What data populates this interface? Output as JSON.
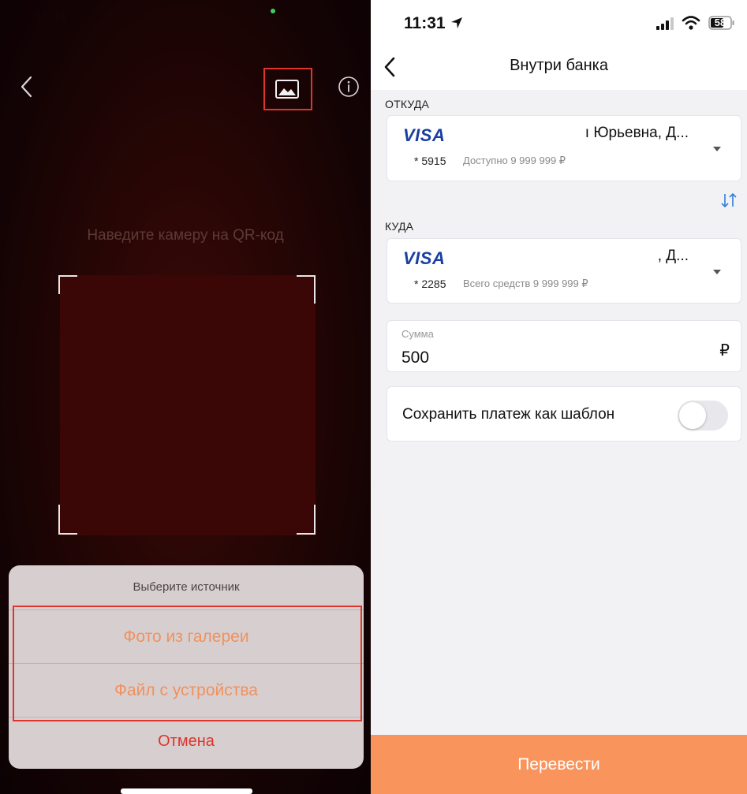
{
  "left": {
    "status_time": "11:31",
    "scan_hint": "Наведите камеру на QR-код",
    "sheet": {
      "title": "Выберите источник",
      "option_gallery": "Фото из галереи",
      "option_file": "Файл с устройства",
      "cancel": "Отмена"
    },
    "icons": {
      "back": "chevron-left-icon",
      "gallery": "image-icon",
      "info": "info-icon"
    },
    "colors": {
      "accent": "#f0915e",
      "cancel": "#e0322b",
      "highlight": "#e0352d"
    }
  },
  "right": {
    "status": {
      "time": "11:31",
      "battery": "58"
    },
    "nav": {
      "title": "Внутри банка"
    },
    "from": {
      "label": "ОТКУДА",
      "brand": "VISA",
      "holder": "ı Юрьевна, Д...",
      "number": "* 5915",
      "balance": "Доступно 9 999 999 ₽"
    },
    "to": {
      "label": "КУДА",
      "brand": "VISA",
      "holder": ", Д...",
      "number": "* 2285",
      "balance": "Всего средств 9 999 999 ₽"
    },
    "amount": {
      "label": "Сумма",
      "value": "500",
      "currency": "₽"
    },
    "template": {
      "label": "Сохранить платеж как шаблон",
      "enabled": false
    },
    "submit": {
      "label": "Перевести"
    },
    "colors": {
      "brand": "#1a3fa0",
      "submit": "#f9945c",
      "swap": "#2f7fd9"
    }
  }
}
